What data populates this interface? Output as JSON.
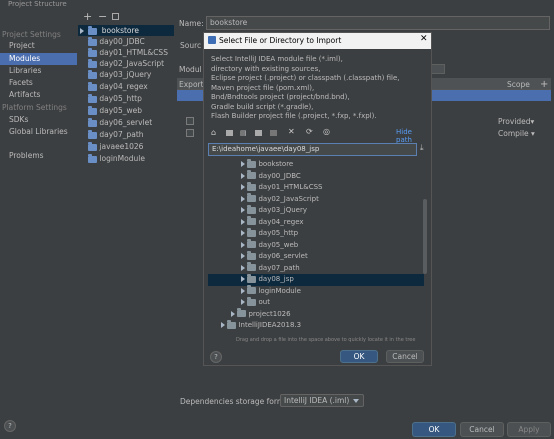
{
  "window": {
    "title": "Project Structure"
  },
  "sidebar": {
    "project_settings_header": "Project Settings",
    "project_settings": [
      "Project",
      "Modules",
      "Libraries",
      "Facets",
      "Artifacts"
    ],
    "platform_settings_header": "Platform Settings",
    "platform_settings": [
      "SDKs",
      "Global Libraries"
    ],
    "other": [
      "Problems"
    ]
  },
  "modules": {
    "items": [
      "bookstore",
      "day00_JDBC",
      "day01_HTML&CSS",
      "day02_JavaScript",
      "day03_jQuery",
      "day04_regex",
      "day05_http",
      "day05_web",
      "day06_servlet",
      "day07_path",
      "javaee1026",
      "loginModule"
    ],
    "selected": "bookstore"
  },
  "right_panel": {
    "name_label": "Name:",
    "name_value": "bookstore",
    "sources_tab": "Sourc",
    "module_label": "Modul",
    "export_header": "Export",
    "scope_header": "Scope",
    "provided": "Provided▾",
    "compile": "Compile ▾",
    "dependencies_label": "Dependencies storage format:",
    "dependencies_value": "IntelliJ IDEA (.iml)"
  },
  "footer": {
    "ok": "OK",
    "cancel": "Cancel",
    "apply": "Apply",
    "help": "?"
  },
  "dialog": {
    "title": "Select File or Directory to Import",
    "description_lines": [
      "Select IntelliJ IDEA module file (*.iml),",
      "directory with existing sources,",
      "Eclipse project (.project) or classpath (.classpath) file,",
      "Maven project file (pom.xml),",
      "Bnd/Bndtools project (project/bnd.bnd),",
      "Gradle build script (*.gradle),",
      "Flash Builder project file (.project, *.fxp, *.fxpl)."
    ],
    "hide_path": "Hide path",
    "path_value": "E:\\ideahome\\javaee\\day08_jsp",
    "tree": [
      {
        "label": "bookstore",
        "depth": 1,
        "expanded": false
      },
      {
        "label": "day00_JDBC",
        "depth": 1,
        "expanded": false
      },
      {
        "label": "day01_HTML&CSS",
        "depth": 1,
        "expanded": false
      },
      {
        "label": "day02_JavaScript",
        "depth": 1,
        "expanded": false
      },
      {
        "label": "day03_jQuery",
        "depth": 1,
        "expanded": false
      },
      {
        "label": "day04_regex",
        "depth": 1,
        "expanded": false
      },
      {
        "label": "day05_http",
        "depth": 1,
        "expanded": false
      },
      {
        "label": "day05_web",
        "depth": 1,
        "expanded": false
      },
      {
        "label": "day06_servlet",
        "depth": 1,
        "expanded": false
      },
      {
        "label": "day07_path",
        "depth": 1,
        "expanded": false
      },
      {
        "label": "day08_jsp",
        "depth": 1,
        "expanded": false,
        "selected": true
      },
      {
        "label": "loginModule",
        "depth": 1,
        "expanded": false
      },
      {
        "label": "out",
        "depth": 1,
        "expanded": false
      },
      {
        "label": "project1026",
        "depth": 0,
        "expanded": false
      },
      {
        "label": "IntelliJIDEA2018.3",
        "depth": -1,
        "expanded": false
      }
    ],
    "hint": "Drag and drop a file into the space above to quickly locate it in the tree",
    "ok": "OK",
    "cancel": "Cancel",
    "help": "?"
  },
  "colors": {
    "accent": "#4b6eaf",
    "selection": "#0d293e",
    "primary_button": "#365880"
  }
}
